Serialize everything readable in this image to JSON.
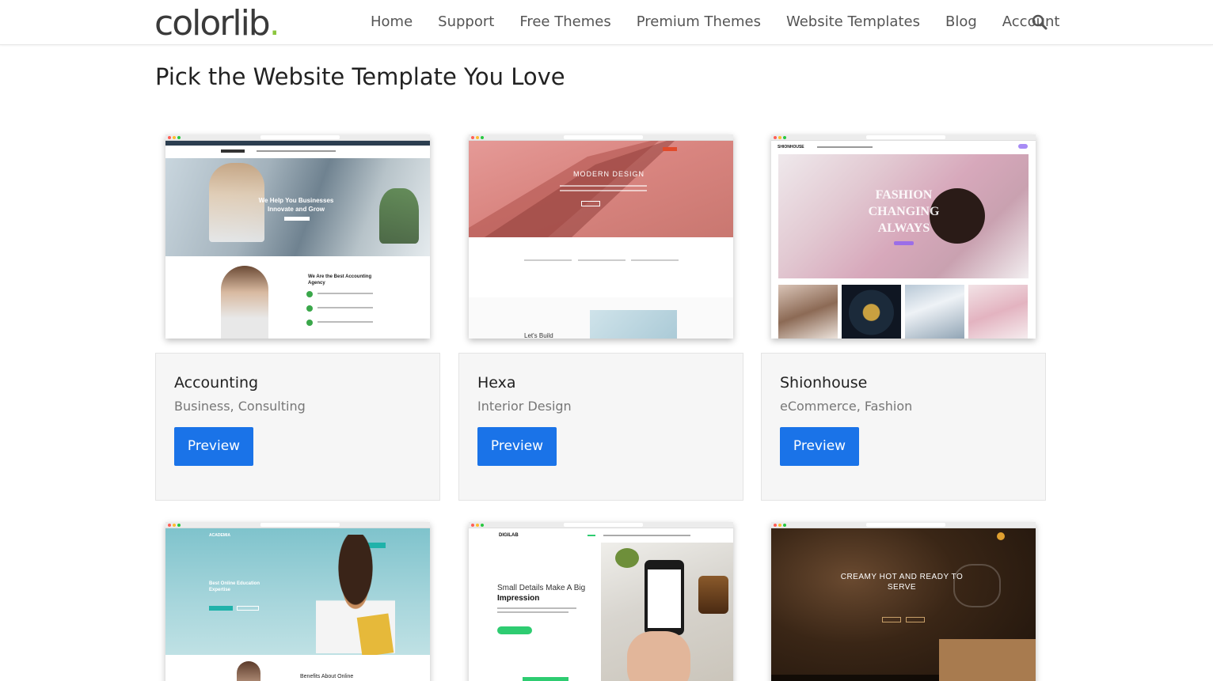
{
  "header": {
    "logo_text": "colorlib",
    "logo_dot": ".",
    "nav": [
      "Home",
      "Support",
      "Free Themes",
      "Premium Themes",
      "Website Templates",
      "Blog",
      "Account"
    ],
    "search_icon": "search-icon"
  },
  "page": {
    "title": "Pick the Website Template You Love"
  },
  "cards": [
    {
      "title": "Accounting",
      "categories": "Business, Consulting",
      "button": "Preview",
      "hero_text": "We Help You Businesses Innovate and Grow",
      "section_text": "We Are the Best Accounting Agency"
    },
    {
      "title": "Hexa",
      "categories": "Interior Design",
      "button": "Preview",
      "hero_text": "MODERN DESIGN",
      "section_text": "Let's Build"
    },
    {
      "title": "Shionhouse",
      "categories": "eCommerce, Fashion",
      "button": "Preview",
      "hero_text": "FASHION CHANGING ALWAYS",
      "brand": "SHIONHOUSE"
    },
    {
      "title": "",
      "categories": "",
      "button": "",
      "brand": "ACADEMIA",
      "hero_text": "Best Online Education Expertise",
      "section_text": "Benefits About Online"
    },
    {
      "title": "",
      "categories": "",
      "button": "",
      "brand": "DIGILAB",
      "hero_text": "Small Details Make A Big",
      "hero_text2": "Impression"
    },
    {
      "title": "",
      "categories": "",
      "button": "",
      "hero_text": "CREAMY HOT AND READY TO SERVE"
    }
  ],
  "colors": {
    "button": "#1a73e8",
    "logo_dot": "#8cc63f",
    "card_bg": "#f6f6f6"
  }
}
